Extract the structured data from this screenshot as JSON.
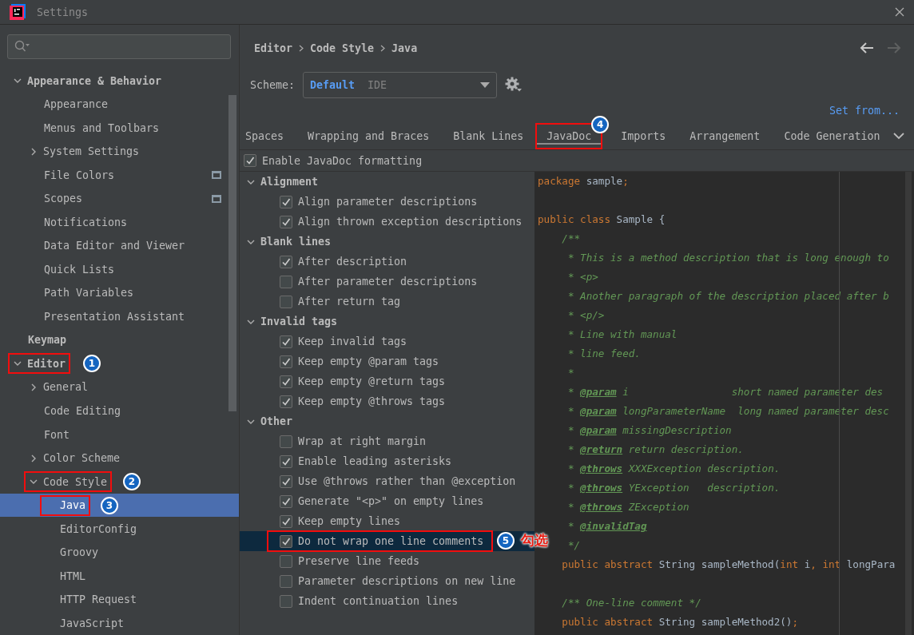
{
  "window": {
    "title": "Settings"
  },
  "sidebar": {
    "items": [
      {
        "label": "Appearance & Behavior",
        "expanded": true,
        "selected": false,
        "children": [
          {
            "label": "Appearance",
            "selected": false
          },
          {
            "label": "Menus and Toolbars",
            "selected": false
          },
          {
            "label": "System Settings",
            "expanded": false,
            "selected": false
          },
          {
            "label": "File Colors",
            "selected": false,
            "project_icon": true
          },
          {
            "label": "Scopes",
            "selected": false,
            "project_icon": true
          },
          {
            "label": "Notifications",
            "selected": false
          },
          {
            "label": "Data Editor and Viewer",
            "selected": false
          },
          {
            "label": "Quick Lists",
            "selected": false
          },
          {
            "label": "Path Variables",
            "selected": false
          },
          {
            "label": "Presentation Assistant",
            "selected": false
          }
        ]
      },
      {
        "label": "Keymap",
        "selected": false
      },
      {
        "label": "Editor",
        "expanded": true,
        "selected": false,
        "marker": "1",
        "children": [
          {
            "label": "General",
            "expanded": false,
            "selected": false
          },
          {
            "label": "Code Editing",
            "selected": false
          },
          {
            "label": "Font",
            "selected": false
          },
          {
            "label": "Color Scheme",
            "expanded": false,
            "selected": false
          },
          {
            "label": "Code Style",
            "expanded": true,
            "selected": false,
            "marker": "2",
            "children": [
              {
                "label": "Java",
                "selected": true,
                "marker": "3"
              },
              {
                "label": "EditorConfig",
                "selected": false
              },
              {
                "label": "Groovy",
                "selected": false
              },
              {
                "label": "HTML",
                "selected": false
              },
              {
                "label": "HTTP Request",
                "selected": false
              },
              {
                "label": "JavaScript",
                "selected": false
              }
            ]
          }
        ]
      }
    ]
  },
  "breadcrumb": [
    "Editor",
    "Code Style",
    "Java"
  ],
  "nav": {
    "back_disabled": false,
    "forward_disabled": true
  },
  "scheme": {
    "label": "Scheme:",
    "value": "Default",
    "sub": "IDE"
  },
  "set_from": "Set from...",
  "tabs": [
    {
      "label": "Spaces",
      "selected": false
    },
    {
      "label": "Wrapping and Braces",
      "selected": false
    },
    {
      "label": "Blank Lines",
      "selected": false
    },
    {
      "label": "JavaDoc",
      "selected": true,
      "marker": "4"
    },
    {
      "label": "Imports",
      "selected": false
    },
    {
      "label": "Arrangement",
      "selected": false
    },
    {
      "label": "Code Generation",
      "selected": false
    }
  ],
  "enable": {
    "label": "Enable JavaDoc formatting",
    "checked": true
  },
  "groups": [
    {
      "title": "Alignment",
      "expanded": true,
      "options": [
        {
          "label": "Align parameter descriptions",
          "checked": true,
          "selected": false
        },
        {
          "label": "Align thrown exception descriptions",
          "checked": true,
          "selected": false
        }
      ]
    },
    {
      "title": "Blank lines",
      "expanded": true,
      "options": [
        {
          "label": "After description",
          "checked": true,
          "selected": false
        },
        {
          "label": "After parameter descriptions",
          "checked": false,
          "selected": false
        },
        {
          "label": "After return tag",
          "checked": false,
          "selected": false
        }
      ]
    },
    {
      "title": "Invalid tags",
      "expanded": true,
      "options": [
        {
          "label": "Keep invalid tags",
          "checked": true,
          "selected": false
        },
        {
          "label": "Keep empty @param tags",
          "checked": true,
          "selected": false
        },
        {
          "label": "Keep empty @return tags",
          "checked": true,
          "selected": false
        },
        {
          "label": "Keep empty @throws tags",
          "checked": true,
          "selected": false
        }
      ]
    },
    {
      "title": "Other",
      "expanded": true,
      "options": [
        {
          "label": "Wrap at right margin",
          "checked": false,
          "selected": false
        },
        {
          "label": "Enable leading asterisks",
          "checked": true,
          "selected": false
        },
        {
          "label": "Use @throws rather than @exception",
          "checked": true,
          "selected": false
        },
        {
          "label": "Generate \"<p>\" on empty lines",
          "checked": true,
          "selected": false
        },
        {
          "label": "Keep empty lines",
          "checked": true,
          "selected": false
        },
        {
          "label": "Do not wrap one line comments",
          "checked": true,
          "selected": true,
          "marker": "5",
          "note": "勾选"
        },
        {
          "label": "Preserve line feeds",
          "checked": false,
          "selected": false
        },
        {
          "label": "Parameter descriptions on new line",
          "checked": false,
          "selected": false
        },
        {
          "label": "Indent continuation lines",
          "checked": false,
          "selected": false
        }
      ]
    }
  ],
  "code": [
    {
      "kind": "top",
      "tokens": [
        {
          "kind": "keyword",
          "t": "package"
        },
        {
          "kind": "plain",
          "t": " sample"
        },
        {
          "kind": "keyword",
          "t": ";"
        }
      ]
    },
    {
      "kind": "blank"
    },
    {
      "kind": "top",
      "tokens": [
        {
          "kind": "keyword",
          "t": "public class"
        },
        {
          "kind": "plain",
          "t": " Sample {"
        }
      ]
    },
    {
      "kind": "member",
      "tokens": [
        {
          "kind": "doc",
          "t": "/**"
        }
      ]
    },
    {
      "kind": "doc_body",
      "tokens": [
        {
          "kind": "doc",
          "t": "* This is a method description that is long enough to"
        }
      ]
    },
    {
      "kind": "doc_body",
      "tokens": [
        {
          "kind": "doc",
          "t": "* <p>"
        }
      ]
    },
    {
      "kind": "doc_body",
      "tokens": [
        {
          "kind": "doc",
          "t": "* Another paragraph of the description placed after b"
        }
      ]
    },
    {
      "kind": "doc_body",
      "tokens": [
        {
          "kind": "doc",
          "t": "* <p/>"
        }
      ]
    },
    {
      "kind": "doc_body",
      "tokens": [
        {
          "kind": "doc",
          "t": "* Line with manual"
        }
      ]
    },
    {
      "kind": "doc_body",
      "tokens": [
        {
          "kind": "doc",
          "t": "* line feed."
        }
      ]
    },
    {
      "kind": "doc_body",
      "tokens": [
        {
          "kind": "doc",
          "t": "*"
        }
      ]
    },
    {
      "kind": "doc_body",
      "tokens": [
        {
          "kind": "doc",
          "t": "* "
        },
        {
          "kind": "tag",
          "t": "@param"
        },
        {
          "kind": "doc",
          "t": " i                 short named parameter des"
        }
      ]
    },
    {
      "kind": "doc_body",
      "tokens": [
        {
          "kind": "doc",
          "t": "* "
        },
        {
          "kind": "tag",
          "t": "@param"
        },
        {
          "kind": "doc",
          "t": " longParameterName  long named parameter desc"
        }
      ]
    },
    {
      "kind": "doc_body",
      "tokens": [
        {
          "kind": "doc",
          "t": "* "
        },
        {
          "kind": "tag",
          "t": "@param"
        },
        {
          "kind": "doc",
          "t": " missingDescription"
        }
      ]
    },
    {
      "kind": "doc_body",
      "tokens": [
        {
          "kind": "doc",
          "t": "* "
        },
        {
          "kind": "tag",
          "t": "@return"
        },
        {
          "kind": "doc",
          "t": " return description."
        }
      ]
    },
    {
      "kind": "doc_body",
      "tokens": [
        {
          "kind": "doc",
          "t": "* "
        },
        {
          "kind": "tag",
          "t": "@throws"
        },
        {
          "kind": "doc",
          "t": " XXXException description."
        }
      ]
    },
    {
      "kind": "doc_body",
      "tokens": [
        {
          "kind": "doc",
          "t": "* "
        },
        {
          "kind": "tag",
          "t": "@throws"
        },
        {
          "kind": "doc",
          "t": " YException   description."
        }
      ]
    },
    {
      "kind": "doc_body",
      "tokens": [
        {
          "kind": "doc",
          "t": "* "
        },
        {
          "kind": "tag",
          "t": "@throws"
        },
        {
          "kind": "doc",
          "t": " ZException"
        }
      ]
    },
    {
      "kind": "doc_body",
      "tokens": [
        {
          "kind": "doc",
          "t": "* "
        },
        {
          "kind": "tag",
          "t": "@invalidTag"
        }
      ]
    },
    {
      "kind": "doc_body",
      "tokens": [
        {
          "kind": "doc",
          "t": "*/"
        }
      ]
    },
    {
      "kind": "member",
      "tokens": [
        {
          "kind": "keyword",
          "t": "public abstract"
        },
        {
          "kind": "plain",
          "t": " String sampleMethod("
        },
        {
          "kind": "keyword",
          "t": "int"
        },
        {
          "kind": "plain",
          "t": " i"
        },
        {
          "kind": "keyword",
          "t": ", int"
        },
        {
          "kind": "plain",
          "t": " longPara"
        }
      ]
    },
    {
      "kind": "blank"
    },
    {
      "kind": "member",
      "tokens": [
        {
          "kind": "doc",
          "t": "/** One-line comment */"
        }
      ]
    },
    {
      "kind": "member",
      "tokens": [
        {
          "kind": "keyword",
          "t": "public abstract"
        },
        {
          "kind": "plain",
          "t": " String sampleMethod2()"
        },
        {
          "kind": "keyword",
          "t": ";"
        }
      ]
    }
  ]
}
